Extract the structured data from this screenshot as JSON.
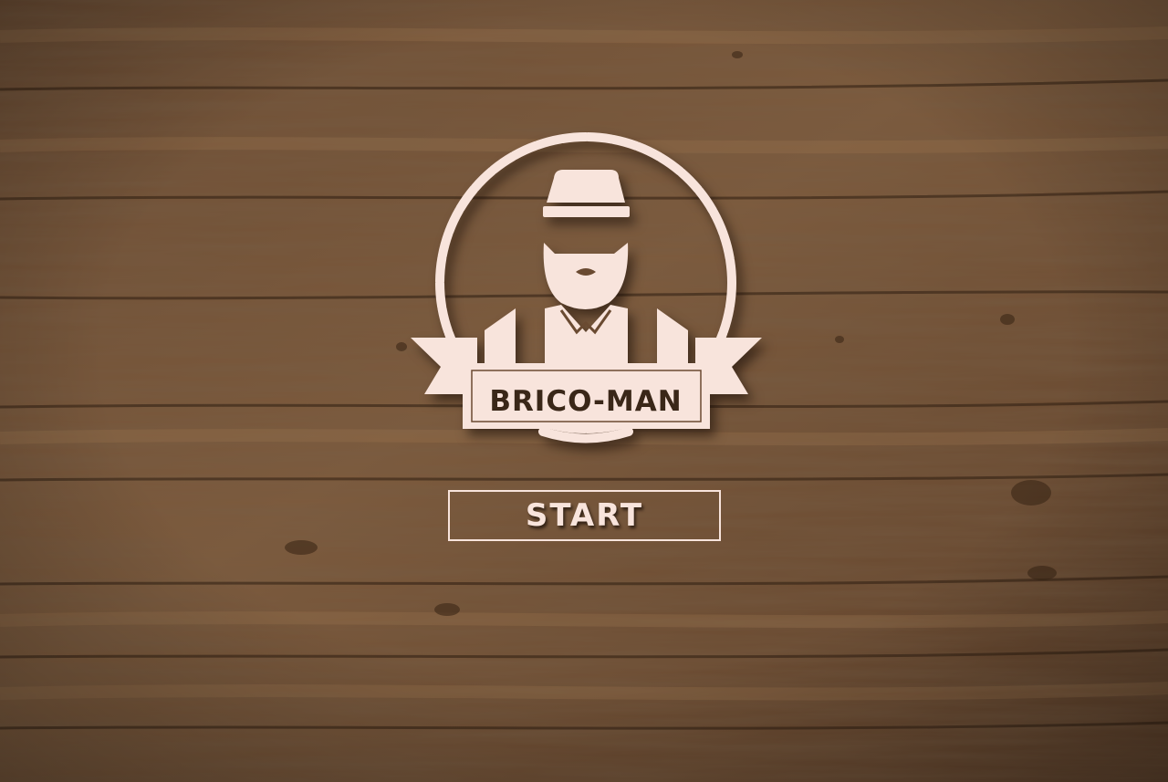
{
  "game": {
    "title": "BRICO-MAN",
    "start_label": "START"
  },
  "icons": {
    "logo": "bearded-handyman-badge-icon",
    "background": "wood-plank-texture"
  },
  "colors": {
    "badge": "#f8e4dc",
    "badge_text": "#3a2718",
    "wood_light": "#8a6444",
    "wood_dark": "#4a301e"
  }
}
